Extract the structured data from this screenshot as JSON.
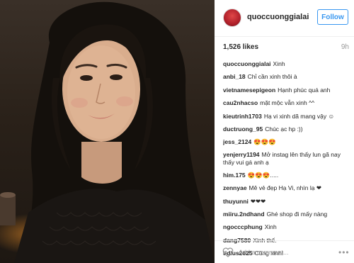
{
  "post": {
    "username": "quoccuonggialai",
    "follow_label": "Follow",
    "likes": "1,526 likes",
    "age": "9h",
    "add_comment_placeholder": "Add a comment...",
    "more_label": "•••"
  },
  "comments": [
    {
      "user": "quoccuonggialai",
      "text": "Xinh"
    },
    {
      "user": "anbi_18",
      "text": "Chỉ cần xinh thôi à"
    },
    {
      "user": "vietnamesepigeon",
      "text": "Hạnh phúc quá anh"
    },
    {
      "user": "cau2nhacso",
      "text": "mặt mộc vẫn xinh ^^"
    },
    {
      "user": "kieutrinh1703",
      "text": "Hạ vi xinh dã mang vậy ☺"
    },
    {
      "user": "ductruong_95",
      "text": "Chúc ạc hp :))"
    },
    {
      "user": "jess_2124",
      "text": "😍😍😍"
    },
    {
      "user": "yenjerry1194",
      "text": "Mở instag lên thấy lun gã nay thấy vui gá anh ạ"
    },
    {
      "user": "him.175",
      "text": "😍😍😍....."
    },
    {
      "user": "zennyae",
      "text": "Mê vẻ đẹp Hạ Vi, nhìn lạ ❤"
    },
    {
      "user": "thuyunni",
      "text": "❤❤❤"
    },
    {
      "user": "miiru.2ndhand",
      "text": "Ghé shop đi mấy nàng"
    },
    {
      "user": "ngocccphung",
      "text": "Xinh"
    },
    {
      "user": "dang7580",
      "text": "Xinh thế."
    },
    {
      "user": "tidius2625",
      "text": "Cũng xinh!"
    }
  ],
  "colors": {
    "accent": "#3897f0",
    "text": "#262626",
    "muted": "#999999",
    "border": "#efefef"
  },
  "icons": {
    "like": "heart-outline-icon",
    "options": "more-options-icon"
  }
}
